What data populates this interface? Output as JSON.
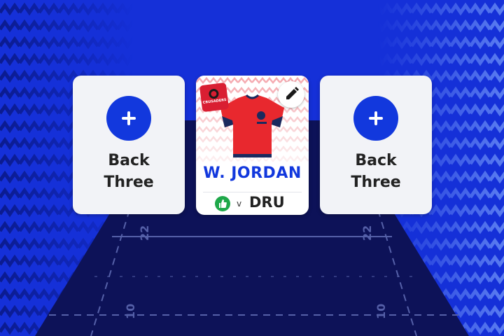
{
  "slots": {
    "left": {
      "label": "Back\nThree"
    },
    "right": {
      "label": "Back\nThree"
    }
  },
  "player": {
    "name": "W. JORDAN",
    "opponent_separator": "v",
    "opponent": "DRU",
    "badge_text": "CRUSADERS",
    "shirt_color": "#e8282e",
    "shirt_trim_color": "#1a2a5e"
  },
  "pitch": {
    "markings": [
      "22",
      "22",
      "10",
      "10"
    ]
  },
  "colors": {
    "background": "#1530d8",
    "accent": "#1238dd",
    "pitch": "#0d1258",
    "like_green": "#1fa84a"
  },
  "icons": [
    "add-icon",
    "edit-icon",
    "thumbs-up-icon"
  ]
}
